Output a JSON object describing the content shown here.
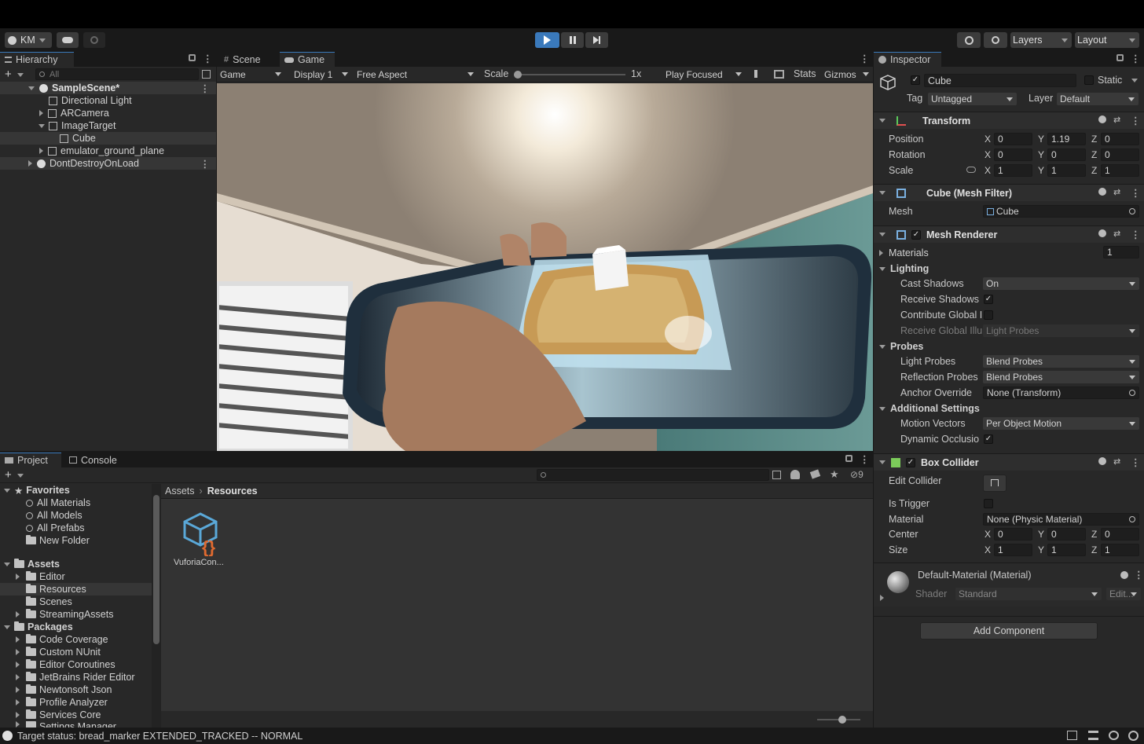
{
  "toolbar": {
    "account": "KM",
    "layers": "Layers",
    "layout": "Layout"
  },
  "hierarchy": {
    "tab": "Hierarchy",
    "search_placeholder": "All",
    "items": [
      {
        "label": "SampleScene*",
        "indent": 0
      },
      {
        "label": "Directional Light",
        "indent": 1
      },
      {
        "label": "ARCamera",
        "indent": 1
      },
      {
        "label": "ImageTarget",
        "indent": 1
      },
      {
        "label": "Cube",
        "indent": 2
      },
      {
        "label": "emulator_ground_plane",
        "indent": 1
      },
      {
        "label": "DontDestroyOnLoad",
        "indent": 0
      }
    ]
  },
  "game": {
    "tab_scene": "Scene",
    "tab_game": "Game",
    "mode": "Game",
    "display": "Display 1",
    "aspect": "Free Aspect",
    "scale_label": "Scale",
    "scale_value": "1x",
    "play_focused": "Play Focused",
    "stats": "Stats",
    "gizmos": "Gizmos"
  },
  "project": {
    "tab_project": "Project",
    "tab_console": "Console",
    "hidden_count": "9",
    "favorites": {
      "label": "Favorites",
      "items": [
        "All Materials",
        "All Models",
        "All Prefabs",
        "New Folder"
      ]
    },
    "assets": {
      "label": "Assets",
      "items": [
        "Editor",
        "Resources",
        "Scenes",
        "StreamingAssets"
      ]
    },
    "packages": {
      "label": "Packages",
      "items": [
        "Code Coverage",
        "Custom NUnit",
        "Editor Coroutines",
        "JetBrains Rider Editor",
        "Newtonsoft Json",
        "Profile Analyzer",
        "Services Core",
        "Settings Manager"
      ]
    },
    "breadcrumb": [
      "Assets",
      "Resources"
    ],
    "asset_label": "VuforiaCon..."
  },
  "inspector": {
    "tab": "Inspector",
    "object_name": "Cube",
    "static_label": "Static",
    "tag_label": "Tag",
    "tag_value": "Untagged",
    "layer_label": "Layer",
    "layer_value": "Default",
    "transform": {
      "title": "Transform",
      "position_label": "Position",
      "rotation_label": "Rotation",
      "scale_label": "Scale",
      "position": [
        "0",
        "1.19",
        "0"
      ],
      "rotation": [
        "0",
        "0",
        "0"
      ],
      "scale": [
        "1",
        "1",
        "1"
      ]
    },
    "mesh_filter": {
      "title": "Cube (Mesh Filter)",
      "mesh_label": "Mesh",
      "mesh_value": "Cube"
    },
    "mesh_renderer": {
      "title": "Mesh Renderer",
      "materials_label": "Materials",
      "materials_count": "1",
      "lighting_label": "Lighting",
      "cast_shadows_label": "Cast Shadows",
      "cast_shadows_value": "On",
      "receive_shadows_label": "Receive Shadows",
      "contribute_gi_label": "Contribute Global I",
      "receive_gi_label": "Receive Global Illu",
      "receive_gi_value": "Light Probes",
      "probes_label": "Probes",
      "light_probes_label": "Light Probes",
      "light_probes_value": "Blend Probes",
      "reflection_probes_label": "Reflection Probes",
      "reflection_probes_value": "Blend Probes",
      "anchor_override_label": "Anchor Override",
      "anchor_override_value": "None (Transform)",
      "additional_label": "Additional Settings",
      "motion_vectors_label": "Motion Vectors",
      "motion_vectors_value": "Per Object Motion",
      "dynamic_occlusion_label": "Dynamic Occlusio"
    },
    "box_collider": {
      "title": "Box Collider",
      "edit_collider_label": "Edit Collider",
      "is_trigger_label": "Is Trigger",
      "material_label": "Material",
      "material_value": "None (Physic Material)",
      "center_label": "Center",
      "size_label": "Size",
      "center": [
        "0",
        "0",
        "0"
      ],
      "size": [
        "1",
        "1",
        "1"
      ]
    },
    "material": {
      "title": "Default-Material (Material)",
      "shader_label": "Shader",
      "shader_value": "Standard",
      "edit_label": "Edit..."
    },
    "add_component": "Add Component"
  },
  "status": {
    "message": "Target status: bread_marker EXTENDED_TRACKED -- NORMAL"
  },
  "colors": {
    "accent": "#3a79bb",
    "panel": "#282828",
    "selection": "#2c5d87"
  }
}
